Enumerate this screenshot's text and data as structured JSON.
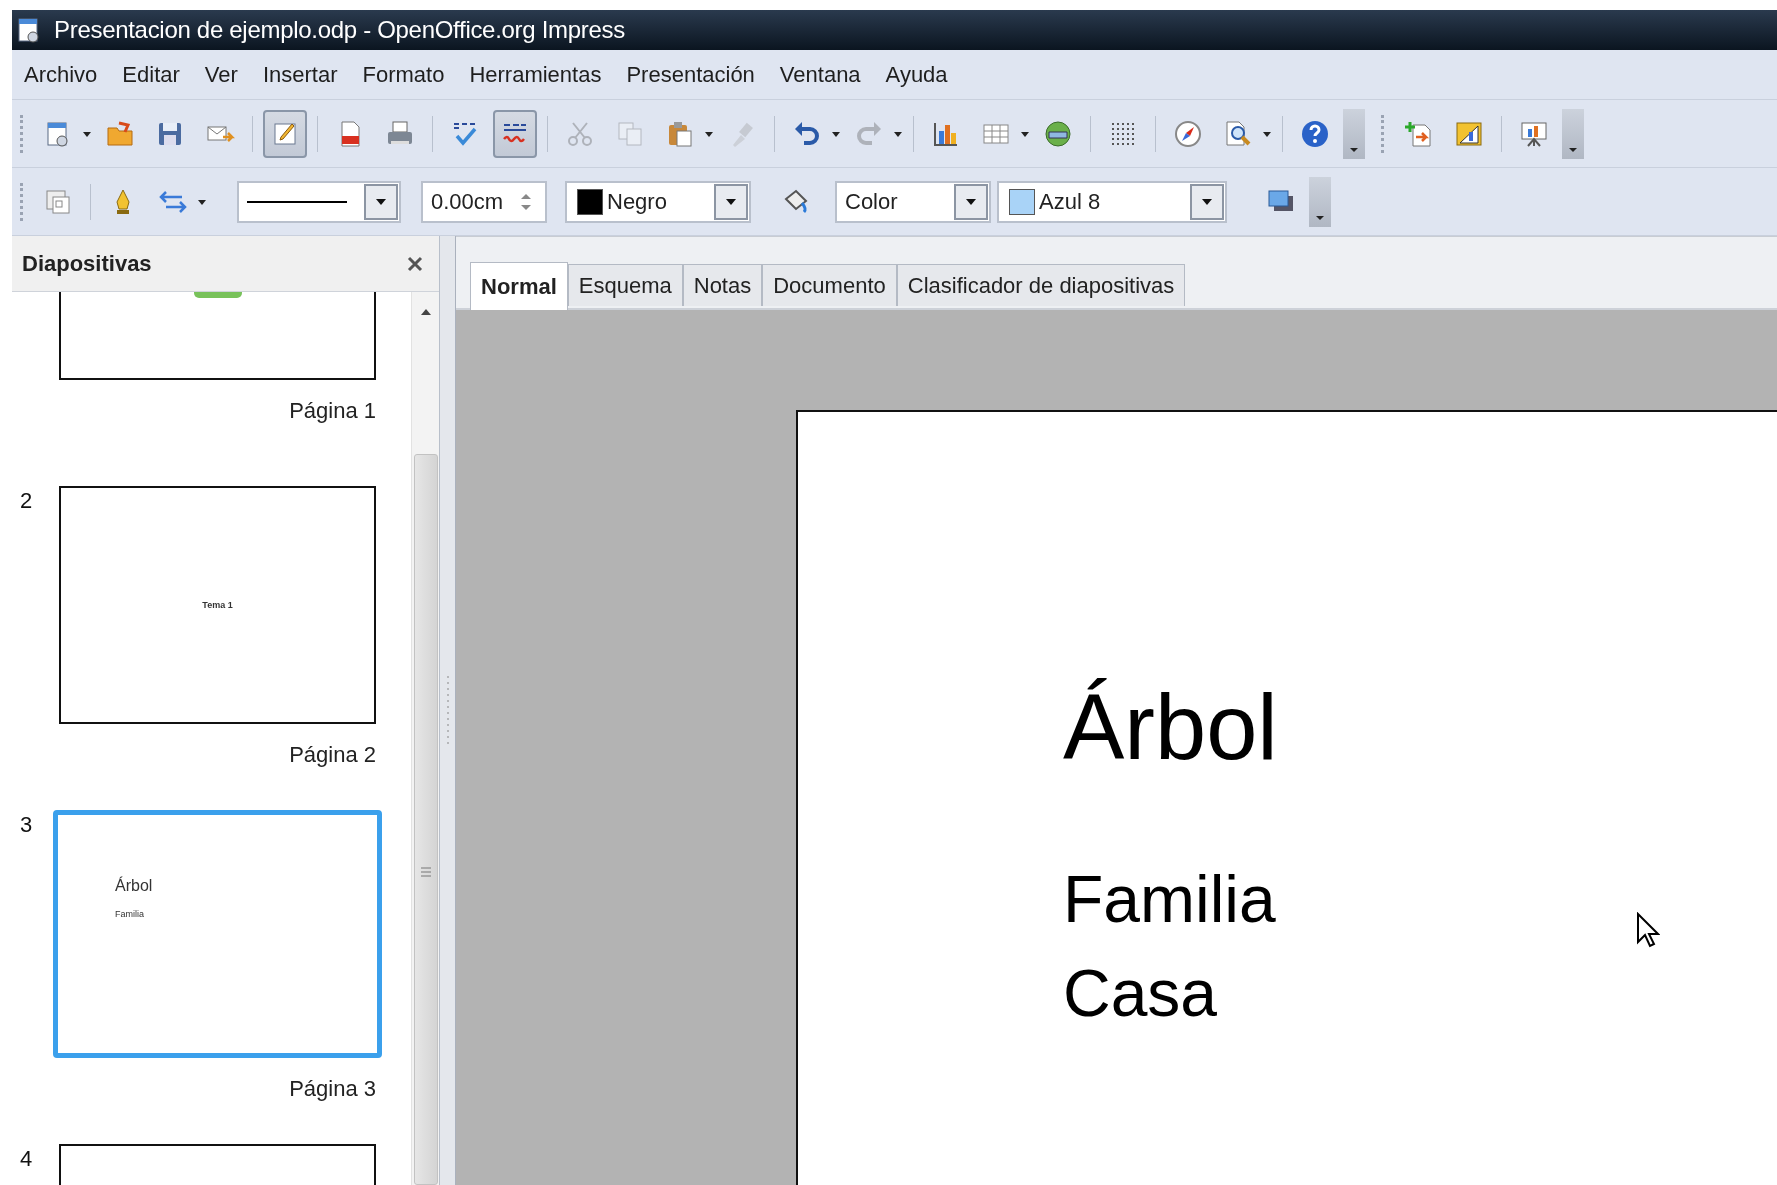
{
  "window": {
    "title": "Presentacion de ejemplo.odp - OpenOffice.org Impress"
  },
  "menu": [
    {
      "label": "Archivo"
    },
    {
      "label": "Editar"
    },
    {
      "label": "Ver"
    },
    {
      "label": "Insertar"
    },
    {
      "label": "Formato"
    },
    {
      "label": "Herramientas"
    },
    {
      "label": "Presentación"
    },
    {
      "label": "Ventana"
    },
    {
      "label": "Ayuda"
    }
  ],
  "standard_toolbar": [
    {
      "pressed": false,
      "disabled": false
    },
    {
      "pressed": false,
      "disabled": false
    },
    {
      "pressed": false,
      "disabled": false
    },
    {
      "pressed": false,
      "disabled": false
    },
    {
      "pressed": true,
      "disabled": false
    },
    {
      "pressed": false,
      "disabled": false
    },
    {
      "pressed": false,
      "disabled": false
    },
    {
      "pressed": false,
      "disabled": false
    },
    {
      "pressed": true,
      "disabled": false
    },
    {
      "pressed": false,
      "disabled": true
    },
    {
      "pressed": false,
      "disabled": true
    },
    {
      "pressed": false,
      "disabled": false
    },
    {
      "pressed": false,
      "disabled": true
    },
    {
      "pressed": false,
      "disabled": false
    },
    {
      "pressed": false,
      "disabled": true
    },
    {
      "pressed": false,
      "disabled": false
    },
    {
      "pressed": false,
      "disabled": false
    },
    {
      "pressed": false,
      "disabled": false
    },
    {
      "pressed": false,
      "disabled": false
    },
    {
      "pressed": false,
      "disabled": false
    },
    {
      "pressed": false,
      "disabled": false
    },
    {
      "pressed": false,
      "disabled": false
    }
  ],
  "line_toolbar": {
    "line_width": "0.00cm",
    "line_color": {
      "label": "Negro",
      "color": "#000000"
    },
    "area_style": "Color",
    "fill": {
      "label": "Azul 8",
      "color": "#a9d3f7"
    }
  },
  "slides_pane": {
    "title": "Diapositivas",
    "slides": [
      {
        "label": "Página 1",
        "selected": false,
        "cut": true
      },
      {
        "number": "2",
        "label": "Página 2",
        "selected": false,
        "texts": [
          {
            "kind": "subtitle",
            "text": "Tema 1"
          }
        ]
      },
      {
        "number": "3",
        "label": "Página 3",
        "selected": true,
        "texts": [
          {
            "kind": "title",
            "text": "Árbol"
          },
          {
            "kind": "body",
            "text": "Familia"
          }
        ]
      },
      {
        "number": "4",
        "selected": false,
        "cut": true
      }
    ]
  },
  "view_tabs": [
    {
      "label": "Normal",
      "selected": true
    },
    {
      "label": "Esquema",
      "selected": false
    },
    {
      "label": "Notas",
      "selected": false
    },
    {
      "label": "Documento",
      "selected": false
    },
    {
      "label": "Clasificador de diapositivas",
      "selected": false
    }
  ],
  "slide": {
    "title": "Árbol",
    "items": [
      "Familia",
      "Casa"
    ]
  }
}
